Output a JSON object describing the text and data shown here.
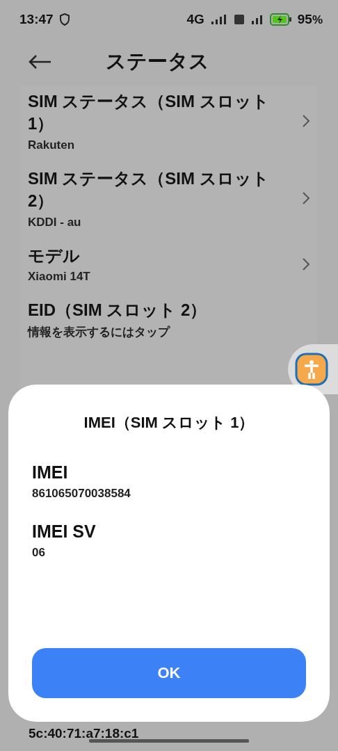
{
  "status_bar": {
    "time": "13:47",
    "network": "4G",
    "battery": "95",
    "battery_unit": "%"
  },
  "header": {
    "title": "ステータス"
  },
  "items": [
    {
      "title": "SIM ステータス（SIM スロット 1）",
      "value": "Rakuten",
      "chevron": true
    },
    {
      "title": "SIM ステータス（SIM スロット 2）",
      "value": "KDDI - au",
      "chevron": true
    },
    {
      "title": "モデル",
      "value": "Xiaomi 14T",
      "chevron": true
    },
    {
      "title": "EID（SIM スロット 2）",
      "value": "情報を表示するにはタップ",
      "chevron": false
    }
  ],
  "bottom_value": "5c:40:71:a7:18:c1",
  "dialog": {
    "title": "IMEI（SIM スロット 1）",
    "fields": [
      {
        "label": "IMEI",
        "value": "861065070038584"
      },
      {
        "label": "IMEI SV",
        "value": "06"
      }
    ],
    "button": "OK"
  }
}
